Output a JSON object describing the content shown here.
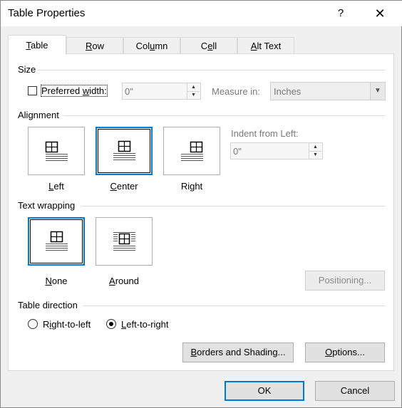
{
  "window": {
    "title": "Table Properties",
    "help_label": "?",
    "close_label": "✕"
  },
  "tabs": [
    {
      "label": "Table",
      "mnemonic": "T",
      "rest": "able",
      "active": true
    },
    {
      "label": "Row",
      "mnemonic": "R",
      "rest": "ow",
      "active": false
    },
    {
      "label": "Column",
      "mnemonic": "U",
      "pre": "Col",
      "rest": "mn",
      "active": false
    },
    {
      "label": "Cell",
      "mnemonic": "E",
      "pre": "C",
      "rest": "ll",
      "active": false
    },
    {
      "label": "Alt Text",
      "mnemonic": "A",
      "rest": "lt Text",
      "active": false
    }
  ],
  "size": {
    "section_label": "Size",
    "preferred_width": {
      "pre": "Preferred ",
      "mnemonic": "w",
      "rest": "idth:",
      "checked": false
    },
    "width_value": "0\"",
    "measure_in_label": "Measure in:",
    "measure_in_value": "Inches"
  },
  "alignment": {
    "section_label": "Alignment",
    "options": [
      {
        "label": "Left",
        "mnemonic": "L",
        "rest": "eft",
        "selected": false
      },
      {
        "label": "Center",
        "mnemonic": "C",
        "rest": "enter",
        "selected": true
      },
      {
        "label": "Right",
        "pre": "Ri",
        "mnemonic": "g",
        "rest": "ht",
        "selected": false
      }
    ],
    "indent_label": "Indent from Left:",
    "indent_value": "0\""
  },
  "text_wrapping": {
    "section_label": "Text wrapping",
    "options": [
      {
        "label": "None",
        "mnemonic": "N",
        "rest": "one",
        "selected": true
      },
      {
        "label": "Around",
        "mnemonic": "A",
        "rest": "round",
        "selected": false
      }
    ],
    "positioning_label": "Positioning..."
  },
  "direction": {
    "section_label": "Table direction",
    "rtl": {
      "pre": "R",
      "mnemonic": "i",
      "rest": "ght-to-left",
      "selected": false
    },
    "ltr": {
      "label": "Left-to-right",
      "mnemonic": "L",
      "pre": "",
      "rest": "eft-to-right",
      "selected": true
    }
  },
  "buttons": {
    "borders": {
      "pre": "",
      "mnemonic": "B",
      "rest": "orders and Shading..."
    },
    "options": {
      "pre": "",
      "mnemonic": "O",
      "rest": "ptions..."
    },
    "ok": "OK",
    "cancel": "Cancel"
  },
  "colors": {
    "accent": "#0078d7",
    "panel": "#ffffff",
    "chrome": "#f0f0f0"
  }
}
